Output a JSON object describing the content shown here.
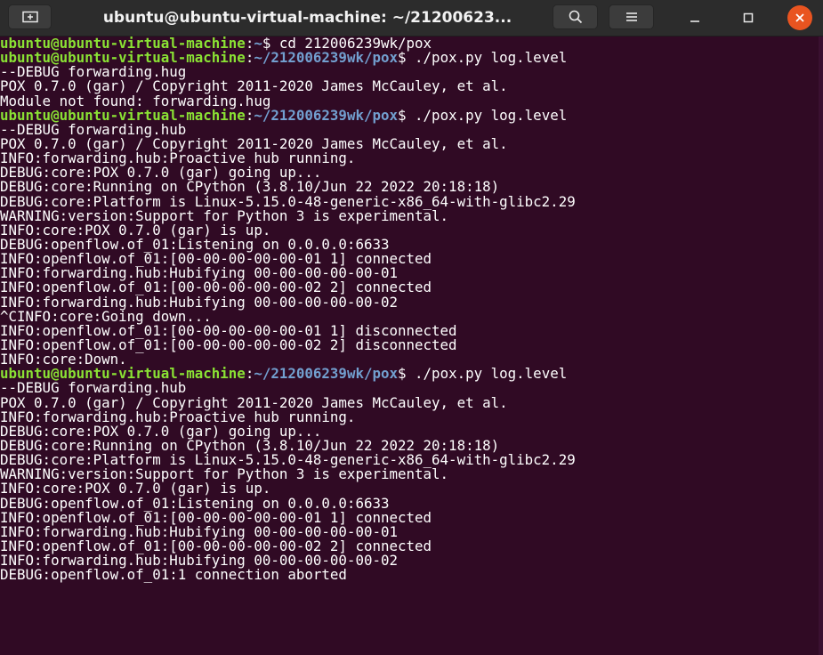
{
  "window": {
    "title": "ubuntu@ubuntu-virtual-machine: ~/21200623..."
  },
  "icons": {
    "new_tab": "new-tab-icon",
    "search": "search-icon",
    "menu": "hamburger-menu-icon",
    "minimize": "minimize-icon",
    "maximize": "maximize-icon",
    "close": "close-icon"
  },
  "colors": {
    "background": "#300a24",
    "prompt_user": "#8ae234",
    "prompt_path": "#729fcf",
    "text": "#ffffff",
    "close_button": "#e95420"
  },
  "terminal": {
    "lines": [
      {
        "user": "ubuntu@ubuntu-virtual-machine",
        "sep": ":",
        "path": "~",
        "rest": "$ cd 212006239wk/pox"
      },
      {
        "user": "ubuntu@ubuntu-virtual-machine",
        "sep": ":",
        "path": "~/212006239wk/pox",
        "rest": "$ ./pox.py log.level"
      },
      {
        "text": "--DEBUG forwarding.hug"
      },
      {
        "text": "POX 0.7.0 (gar) / Copyright 2011-2020 James McCauley, et al."
      },
      {
        "text": "Module not found: forwarding.hug"
      },
      {
        "user": "ubuntu@ubuntu-virtual-machine",
        "sep": ":",
        "path": "~/212006239wk/pox",
        "rest": "$ ./pox.py log.level"
      },
      {
        "text": "--DEBUG forwarding.hub"
      },
      {
        "text": "POX 0.7.0 (gar) / Copyright 2011-2020 James McCauley, et al."
      },
      {
        "text": "INFO:forwarding.hub:Proactive hub running."
      },
      {
        "text": "DEBUG:core:POX 0.7.0 (gar) going up..."
      },
      {
        "text": "DEBUG:core:Running on CPython (3.8.10/Jun 22 2022 20:18:18)"
      },
      {
        "text": "DEBUG:core:Platform is Linux-5.15.0-48-generic-x86_64-with-glibc2.29"
      },
      {
        "text": "WARNING:version:Support for Python 3 is experimental."
      },
      {
        "text": "INFO:core:POX 0.7.0 (gar) is up."
      },
      {
        "text": "DEBUG:openflow.of_01:Listening on 0.0.0.0:6633"
      },
      {
        "text": "INFO:openflow.of_01:[00-00-00-00-00-01 1] connected"
      },
      {
        "text": "INFO:forwarding.hub:Hubifying 00-00-00-00-00-01"
      },
      {
        "text": "INFO:openflow.of_01:[00-00-00-00-00-02 2] connected"
      },
      {
        "text": "INFO:forwarding.hub:Hubifying 00-00-00-00-00-02"
      },
      {
        "text": "^CINFO:core:Going down..."
      },
      {
        "text": "INFO:openflow.of_01:[00-00-00-00-00-01 1] disconnected"
      },
      {
        "text": "INFO:openflow.of_01:[00-00-00-00-00-02 2] disconnected"
      },
      {
        "text": "INFO:core:Down."
      },
      {
        "user": "ubuntu@ubuntu-virtual-machine",
        "sep": ":",
        "path": "~/212006239wk/pox",
        "rest": "$ ./pox.py log.level"
      },
      {
        "text": "--DEBUG forwarding.hub"
      },
      {
        "text": "POX 0.7.0 (gar) / Copyright 2011-2020 James McCauley, et al."
      },
      {
        "text": "INFO:forwarding.hub:Proactive hub running."
      },
      {
        "text": "DEBUG:core:POX 0.7.0 (gar) going up..."
      },
      {
        "text": "DEBUG:core:Running on CPython (3.8.10/Jun 22 2022 20:18:18)"
      },
      {
        "text": "DEBUG:core:Platform is Linux-5.15.0-48-generic-x86_64-with-glibc2.29"
      },
      {
        "text": "WARNING:version:Support for Python 3 is experimental."
      },
      {
        "text": "INFO:core:POX 0.7.0 (gar) is up."
      },
      {
        "text": "DEBUG:openflow.of_01:Listening on 0.0.0.0:6633"
      },
      {
        "text": "INFO:openflow.of_01:[00-00-00-00-00-01 1] connected"
      },
      {
        "text": "INFO:forwarding.hub:Hubifying 00-00-00-00-00-01"
      },
      {
        "text": "INFO:openflow.of_01:[00-00-00-00-00-02 2] connected"
      },
      {
        "text": "INFO:forwarding.hub:Hubifying 00-00-00-00-00-02"
      },
      {
        "text": "DEBUG:openflow.of_01:1 connection aborted"
      }
    ]
  }
}
